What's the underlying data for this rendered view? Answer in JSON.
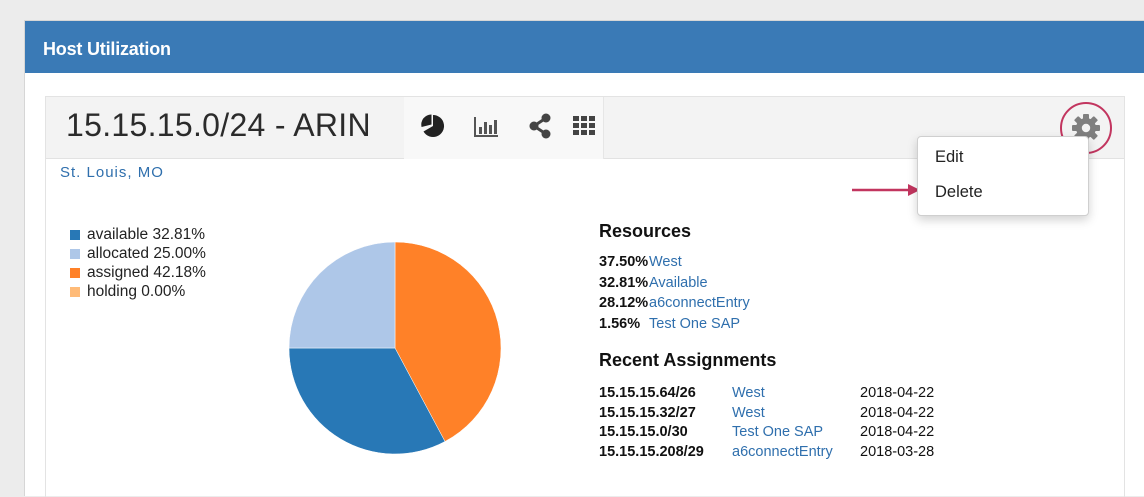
{
  "panel": {
    "title": "Host Utilization"
  },
  "block": {
    "title": "15.15.15.0/24 - ARIN",
    "location": "St. Louis, MO",
    "views": [
      {
        "name": "pie-chart-icon"
      },
      {
        "name": "bar-chart-icon"
      },
      {
        "name": "share-icon"
      },
      {
        "name": "grid-icon"
      }
    ],
    "settings_icon": "gear-icon"
  },
  "menu": {
    "edit": "Edit",
    "delete": "Delete"
  },
  "legend": [
    {
      "label": "available 32.81%",
      "color": "#2878b6"
    },
    {
      "label": "allocated 25.00%",
      "color": "#aec7e8"
    },
    {
      "label": "assigned 42.18%",
      "color": "#ff8128"
    },
    {
      "label": "holding 0.00%",
      "color": "#ffbb78"
    }
  ],
  "chart_data": {
    "type": "pie",
    "title": "",
    "slices": [
      {
        "label": "available",
        "value": 32.81,
        "color": "#2878b6"
      },
      {
        "label": "allocated",
        "value": 25.0,
        "color": "#aec7e8"
      },
      {
        "label": "assigned",
        "value": 42.18,
        "color": "#ff8128"
      },
      {
        "label": "holding",
        "value": 0.0,
        "color": "#ffbb78"
      }
    ]
  },
  "resources": {
    "heading": "Resources",
    "items": [
      {
        "pct": "37.50%",
        "name": "West"
      },
      {
        "pct": "32.81%",
        "name": "Available"
      },
      {
        "pct": "28.12%",
        "name": "a6connectEntry"
      },
      {
        "pct": "1.56%",
        "name": "Test One SAP"
      }
    ]
  },
  "recent": {
    "heading": "Recent Assignments",
    "items": [
      {
        "net": "15.15.15.64/26",
        "name": "West",
        "date": "2018-04-22"
      },
      {
        "net": "15.15.15.32/27",
        "name": "West",
        "date": "2018-04-22"
      },
      {
        "net": "15.15.15.0/30",
        "name": "Test One SAP",
        "date": "2018-04-22"
      },
      {
        "net": "15.15.15.208/29",
        "name": "a6connectEntry",
        "date": "2018-03-28"
      }
    ]
  },
  "colors": {
    "header": "#3a7ab6",
    "link": "#2f6fad",
    "highlight": "#c2355f"
  }
}
